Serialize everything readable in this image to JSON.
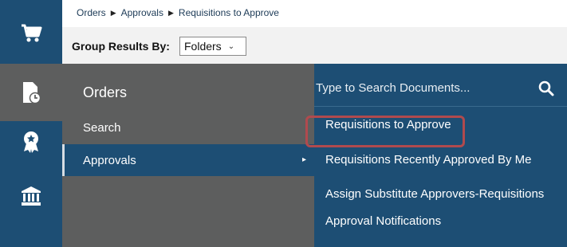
{
  "breadcrumb": {
    "items": [
      "Orders",
      "Approvals",
      "Requisitions to Approve"
    ],
    "separator": "▶"
  },
  "group_bar": {
    "label": "Group Results By:",
    "selected": "Folders"
  },
  "rail": {
    "items": [
      {
        "icon": "shopping-cart-icon",
        "active": false
      },
      {
        "icon": "document-clock-icon",
        "active": true
      },
      {
        "icon": "award-ribbon-icon",
        "active": false
      },
      {
        "icon": "bank-building-icon",
        "active": false
      }
    ]
  },
  "left_menu": {
    "title": "Orders",
    "items": [
      {
        "label": "Search",
        "active": false
      },
      {
        "label": "Approvals",
        "active": true
      }
    ]
  },
  "right_menu": {
    "search_placeholder": "Type to Search Documents...",
    "items": [
      {
        "label": "Requisitions to Approve",
        "highlighted": true
      },
      {
        "label": "Requisitions Recently Approved By Me"
      },
      {
        "label": "Assign Substitute Approvers-Requisitions"
      },
      {
        "label": "Approval Notifications"
      }
    ]
  },
  "colors": {
    "navy": "#1d4e74",
    "gray_panel": "#5d5e5e",
    "highlight": "#b04a4e"
  }
}
